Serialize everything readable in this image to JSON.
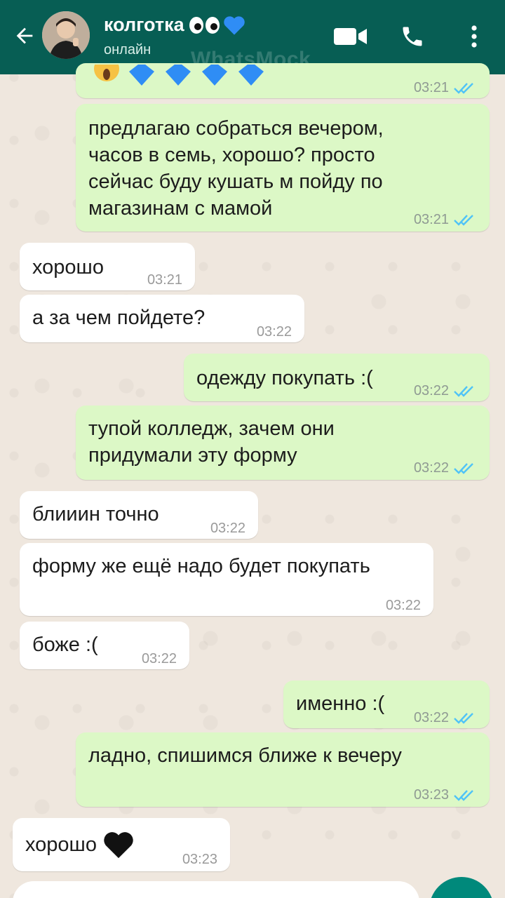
{
  "header": {
    "contact_name": "колготка",
    "status": "онлайн",
    "watermark": "WhatsMock"
  },
  "messages": [
    {
      "dir": "out",
      "text": "",
      "time": "03:21",
      "emoji_row": true
    },
    {
      "dir": "out",
      "text": "предлагаю собраться вечером, часов в семь, хорошо? просто сейчас буду кушать м пойду по магазинам с мамой",
      "time": "03:21"
    },
    {
      "dir": "in",
      "text": "хорошо",
      "time": "03:21"
    },
    {
      "dir": "in",
      "text": "а за чем пойдете?",
      "time": "03:22"
    },
    {
      "dir": "out",
      "text": "одежду покупать :(",
      "time": "03:22"
    },
    {
      "dir": "out",
      "text": "тупой колледж, зачем они придумали эту форму",
      "time": "03:22"
    },
    {
      "dir": "in",
      "text": "блииин точно",
      "time": "03:22"
    },
    {
      "dir": "in",
      "text": "форму же ещё надо будет покупать",
      "time": "03:22"
    },
    {
      "dir": "in",
      "text": "боже :(",
      "time": "03:22"
    },
    {
      "dir": "out",
      "text": "именно :(",
      "time": "03:22"
    },
    {
      "dir": "out",
      "text": "ладно, спишимся ближе к вечеру",
      "time": "03:23"
    },
    {
      "dir": "in",
      "text": "хорошо",
      "time": "03:23",
      "emoji": "black-heart"
    }
  ],
  "colors": {
    "header": "#075e54",
    "outgoing_bubble": "#dcf8c6",
    "incoming_bubble": "#ffffff",
    "read_ticks": "#4fc3f7",
    "fab": "#00897b"
  },
  "icons": [
    "back-arrow-icon",
    "video-call-icon",
    "phone-icon",
    "more-menu-icon",
    "eyes-icon",
    "blue-heart-icon",
    "black-heart-icon",
    "read-ticks-icon"
  ]
}
